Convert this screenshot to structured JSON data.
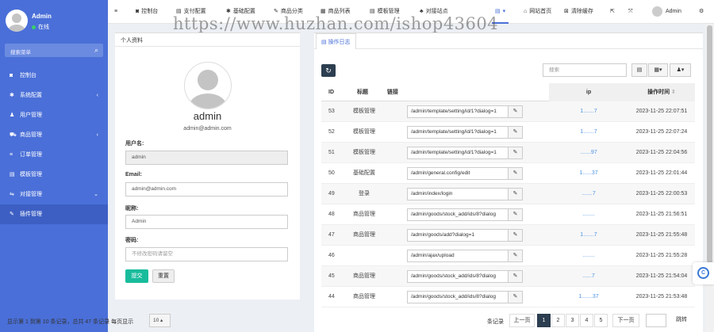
{
  "sidebar": {
    "user": {
      "name": "Admin",
      "status": "在线"
    },
    "search_placeholder": "搜索菜单",
    "items": [
      {
        "label": "控制台",
        "icon": "dashboard-icon",
        "glyph": "◙",
        "chev": ""
      },
      {
        "label": "系统配置",
        "icon": "gear-icon",
        "glyph": "✱",
        "chev": "‹"
      },
      {
        "label": "用户管理",
        "icon": "user-icon",
        "glyph": "♟",
        "chev": ""
      },
      {
        "label": "商品管理",
        "icon": "cart-icon",
        "glyph": "⛟",
        "chev": "‹"
      },
      {
        "label": "订单管理",
        "icon": "list-icon",
        "glyph": "≡",
        "chev": ""
      },
      {
        "label": "模板管理",
        "icon": "template-icon",
        "glyph": "▤",
        "chev": ""
      },
      {
        "label": "对接管理",
        "icon": "sliders-icon",
        "glyph": "⇋",
        "chev": "⌄"
      },
      {
        "label": "插件管理",
        "icon": "plugin-icon",
        "glyph": "✎",
        "chev": ""
      }
    ]
  },
  "topbar": {
    "items": [
      {
        "label": "",
        "glyph": "≡"
      },
      {
        "label": "控制台",
        "glyph": "◙"
      },
      {
        "label": "支付配置",
        "glyph": "▤"
      },
      {
        "label": "基础配置",
        "glyph": "✱"
      },
      {
        "label": "商品分类",
        "glyph": "✎"
      },
      {
        "label": "商品列表",
        "glyph": "▦"
      },
      {
        "label": "模板管理",
        "glyph": "▤"
      },
      {
        "label": "对接站点",
        "glyph": "♣"
      },
      {
        "label": "",
        "glyph": "▤"
      },
      {
        "label": "网站首页",
        "glyph": "⌂"
      },
      {
        "label": "清除缓存",
        "glyph": "⊠"
      },
      {
        "label": "",
        "glyph": "⇱"
      },
      {
        "label": "",
        "glyph": "⤧"
      },
      {
        "label": "Admin",
        "glyph": ""
      },
      {
        "label": "",
        "glyph": "⚙"
      }
    ],
    "dropdown_caret": "▾"
  },
  "watermark": "https://www.huzhan.com/ishop43604",
  "profile": {
    "tab": "个人资料",
    "name": "admin",
    "email_display": "admin@admin.com",
    "fields": {
      "username_label": "用户名:",
      "username_value": "admin",
      "email_label": "Email:",
      "email_value": "admin@admin.com",
      "nickname_label": "昵称:",
      "nickname_value": "Admin",
      "password_label": "密码:",
      "password_placeholder": "不修改密码请留空"
    },
    "submit": "提交",
    "reset": "重置"
  },
  "log": {
    "tab": "操作日志",
    "search_placeholder": "搜索",
    "columns": {
      "id": "ID",
      "title": "标题",
      "url": "链接",
      "ip": "ip",
      "time": "操作时间"
    },
    "rows": [
      {
        "id": "53",
        "title": "模板管理",
        "url": "/admin/template/setting/id/1?dialog=1",
        "ip": "1.......7",
        "time": "2023-11-25 22:07:51"
      },
      {
        "id": "52",
        "title": "模板管理",
        "url": "/admin/template/setting/id/1?dialog=1",
        "ip": "1.......7",
        "time": "2023-11-25 22:07:24"
      },
      {
        "id": "51",
        "title": "模板管理",
        "url": "/admin/template/setting/id/1?dialog=1",
        "ip": ".......97",
        "time": "2023-11-25 22:04:56"
      },
      {
        "id": "50",
        "title": "基础配置",
        "url": "/admin/general.config/edit",
        "ip": "1......37",
        "time": "2023-11-25 22:01:44"
      },
      {
        "id": "49",
        "title": "登录",
        "url": "/admin/index/login",
        "ip": ".......7",
        "time": "2023-11-25 22:00:53"
      },
      {
        "id": "48",
        "title": "商品管理",
        "url": "/admin/goods/stock_add/ids/8?dialog",
        "ip": "........",
        "time": "2023-11-25 21:56:51"
      },
      {
        "id": "47",
        "title": "商品管理",
        "url": "/admin/goods/add?dialog=1",
        "ip": "1.......7",
        "time": "2023-11-25 21:55:48"
      },
      {
        "id": "46",
        "title": "",
        "url": "/admin/ajax/upload",
        "ip": "........",
        "time": "2023-11-25 21:55:28"
      },
      {
        "id": "45",
        "title": "商品管理",
        "url": "/admin/goods/stock_add/ids/8?dialog",
        "ip": "......7",
        "time": "2023-11-25 21:54:04"
      },
      {
        "id": "44",
        "title": "商品管理",
        "url": "/admin/goods/stock_add/ids/8?dialog",
        "ip": "1.......37",
        "time": "2023-11-25 21:53:48"
      }
    ],
    "footer": {
      "summary": "显示第 1 到第 10 条记录，总共 47 条记录 每页显示",
      "page_size": "10",
      "per_page_suffix": "条记录",
      "prev": "上一页",
      "pages": [
        "1",
        "2",
        "3",
        "4",
        "5"
      ],
      "next": "下一页",
      "jump": "跳转"
    }
  }
}
